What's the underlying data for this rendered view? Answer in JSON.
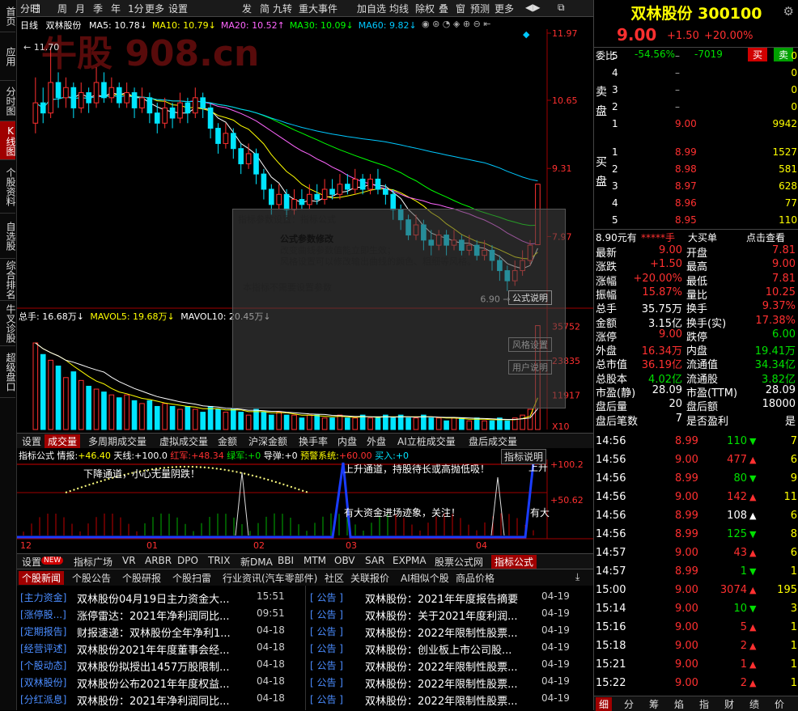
{
  "left_tabs": [
    "首页",
    "应用",
    "分时图",
    "K线图",
    "个股资料",
    "自选股",
    "综合排名",
    "牛叉诊股",
    "超级盘口"
  ],
  "toolbar": [
    "分时",
    "日",
    "周",
    "月",
    "季",
    "年",
    "1分",
    "更多",
    "设置",
    "发",
    "简",
    "九转",
    "重大事件",
    "加自选",
    "均线",
    "除权",
    "叠",
    "窗",
    "预测",
    "更多"
  ],
  "chart": {
    "period": "日线",
    "name": "双林股份",
    "ma": [
      {
        "label": "MA5:",
        "value": "10.78",
        "arrow": "↓",
        "color": "#ffffff"
      },
      {
        "label": "MA10:",
        "value": "10.79",
        "arrow": "↓",
        "color": "#ffff00"
      },
      {
        "label": "MA20:",
        "value": "10.52",
        "arrow": "↑",
        "color": "#ff66ff"
      },
      {
        "label": "MA30:",
        "value": "10.09",
        "arrow": "↓",
        "color": "#00ff00"
      },
      {
        "label": "MA60:",
        "value": "9.82",
        "arrow": "↓",
        "color": "#00c8ff"
      }
    ],
    "y_labels": [
      "11.97",
      "10.65",
      "9.31",
      "7.97"
    ],
    "high_label": "11.70",
    "low_label": "6.90",
    "watermark": "牛股 908.cn",
    "vol_legend": {
      "total": "总手: 16.68万↓",
      "mavol5": "MAVOL5: 19.68万↓",
      "mavol10": "MAVOL10: 20.45万↓"
    },
    "vol_y_labels": [
      "35752",
      "23835",
      "11917",
      "X10"
    ],
    "overlay": {
      "title": "指标参数设置：指标公式",
      "heading": "公式参数修改",
      "line1": "改变曲线参数值能立即生效；",
      "line2": "风格设置可以修改输出曲线的颜色、粗细等风格。",
      "note": "本指标不需要设置参数",
      "btn1": "公式说明",
      "btn2": "风格设置",
      "btn3": "用户说明"
    }
  },
  "chart_data": {
    "type": "candlestick",
    "candles": [
      {
        "o": 10.2,
        "c": 10.6,
        "h": 11.1,
        "l": 10.0
      },
      {
        "o": 10.6,
        "c": 10.4,
        "h": 10.9,
        "l": 10.2
      },
      {
        "o": 10.4,
        "c": 11.0,
        "h": 11.7,
        "l": 10.3
      },
      {
        "o": 11.0,
        "c": 10.7,
        "h": 11.2,
        "l": 10.5
      },
      {
        "o": 10.7,
        "c": 10.9,
        "h": 11.1,
        "l": 10.5
      },
      {
        "o": 10.9,
        "c": 10.5,
        "h": 11.0,
        "l": 10.3
      },
      {
        "o": 10.5,
        "c": 10.8,
        "h": 11.0,
        "l": 10.4
      },
      {
        "o": 10.8,
        "c": 10.6,
        "h": 10.9,
        "l": 10.4
      },
      {
        "o": 10.6,
        "c": 11.0,
        "h": 11.3,
        "l": 10.5
      },
      {
        "o": 11.0,
        "c": 10.7,
        "h": 11.2,
        "l": 10.6
      },
      {
        "o": 10.7,
        "c": 10.9,
        "h": 11.1,
        "l": 10.6
      },
      {
        "o": 10.9,
        "c": 10.6,
        "h": 11.0,
        "l": 10.5
      },
      {
        "o": 10.6,
        "c": 10.8,
        "h": 11.0,
        "l": 10.5
      },
      {
        "o": 10.8,
        "c": 10.5,
        "h": 10.9,
        "l": 10.3
      },
      {
        "o": 10.5,
        "c": 10.7,
        "h": 10.9,
        "l": 10.4
      },
      {
        "o": 10.7,
        "c": 10.4,
        "h": 10.8,
        "l": 10.2
      },
      {
        "o": 10.4,
        "c": 10.2,
        "h": 10.6,
        "l": 10.0
      },
      {
        "o": 10.2,
        "c": 10.5,
        "h": 10.7,
        "l": 10.1
      },
      {
        "o": 10.5,
        "c": 10.3,
        "h": 10.6,
        "l": 10.1
      },
      {
        "o": 10.3,
        "c": 10.6,
        "h": 10.8,
        "l": 10.2
      },
      {
        "o": 10.6,
        "c": 10.4,
        "h": 10.7,
        "l": 10.2
      },
      {
        "o": 10.4,
        "c": 10.7,
        "h": 10.9,
        "l": 10.3
      },
      {
        "o": 10.7,
        "c": 10.5,
        "h": 10.8,
        "l": 10.3
      },
      {
        "o": 10.5,
        "c": 10.1,
        "h": 10.6,
        "l": 9.9
      },
      {
        "o": 10.1,
        "c": 9.8,
        "h": 10.2,
        "l": 9.6
      },
      {
        "o": 9.8,
        "c": 10.0,
        "h": 10.2,
        "l": 9.7
      },
      {
        "o": 10.0,
        "c": 9.7,
        "h": 10.1,
        "l": 9.5
      },
      {
        "o": 9.7,
        "c": 9.4,
        "h": 9.8,
        "l": 9.2
      },
      {
        "o": 9.4,
        "c": 9.6,
        "h": 9.8,
        "l": 9.3
      },
      {
        "o": 9.6,
        "c": 9.2,
        "h": 9.7,
        "l": 9.0
      },
      {
        "o": 9.2,
        "c": 8.9,
        "h": 9.3,
        "l": 8.7
      },
      {
        "o": 8.9,
        "c": 8.6,
        "h": 9.0,
        "l": 8.4
      },
      {
        "o": 8.6,
        "c": 8.8,
        "h": 9.0,
        "l": 8.5
      },
      {
        "o": 8.8,
        "c": 8.5,
        "h": 8.9,
        "l": 8.3
      },
      {
        "o": 8.5,
        "c": 8.7,
        "h": 8.9,
        "l": 8.4
      },
      {
        "o": 8.7,
        "c": 8.6,
        "h": 8.9,
        "l": 8.5
      },
      {
        "o": 8.6,
        "c": 8.8,
        "h": 9.0,
        "l": 8.5
      },
      {
        "o": 8.8,
        "c": 8.7,
        "h": 9.0,
        "l": 8.6
      },
      {
        "o": 8.7,
        "c": 8.9,
        "h": 9.1,
        "l": 8.6
      },
      {
        "o": 8.9,
        "c": 8.8,
        "h": 9.1,
        "l": 8.7
      },
      {
        "o": 8.8,
        "c": 9.0,
        "h": 9.2,
        "l": 8.7
      },
      {
        "o": 9.0,
        "c": 8.9,
        "h": 9.2,
        "l": 8.8
      },
      {
        "o": 8.9,
        "c": 9.1,
        "h": 9.3,
        "l": 8.8
      },
      {
        "o": 9.1,
        "c": 8.9,
        "h": 9.2,
        "l": 8.8
      },
      {
        "o": 8.9,
        "c": 9.1,
        "h": 9.2,
        "l": 8.8
      },
      {
        "o": 9.1,
        "c": 8.9,
        "h": 9.3,
        "l": 8.8
      },
      {
        "o": 8.9,
        "c": 8.8,
        "h": 9.0,
        "l": 8.6
      },
      {
        "o": 8.8,
        "c": 8.5,
        "h": 8.9,
        "l": 8.3
      },
      {
        "o": 8.5,
        "c": 8.3,
        "h": 8.6,
        "l": 8.1
      },
      {
        "o": 8.3,
        "c": 8.0,
        "h": 8.4,
        "l": 7.9
      },
      {
        "o": 8.0,
        "c": 8.2,
        "h": 8.4,
        "l": 7.9
      },
      {
        "o": 8.2,
        "c": 7.9,
        "h": 8.3,
        "l": 7.7
      },
      {
        "o": 7.9,
        "c": 7.8,
        "h": 8.1,
        "l": 7.6
      },
      {
        "o": 7.8,
        "c": 8.0,
        "h": 8.1,
        "l": 7.7
      },
      {
        "o": 8.0,
        "c": 7.8,
        "h": 8.1,
        "l": 7.6
      },
      {
        "o": 7.8,
        "c": 7.9,
        "h": 8.1,
        "l": 7.7
      },
      {
        "o": 7.9,
        "c": 7.7,
        "h": 8.0,
        "l": 7.6
      },
      {
        "o": 7.7,
        "c": 7.8,
        "h": 8.0,
        "l": 7.6
      },
      {
        "o": 7.8,
        "c": 7.6,
        "h": 7.9,
        "l": 7.5
      },
      {
        "o": 7.6,
        "c": 7.7,
        "h": 7.9,
        "l": 7.5
      },
      {
        "o": 7.7,
        "c": 7.5,
        "h": 7.8,
        "l": 7.3
      },
      {
        "o": 7.5,
        "c": 7.3,
        "h": 7.6,
        "l": 7.1
      },
      {
        "o": 7.3,
        "c": 7.1,
        "h": 7.4,
        "l": 6.9
      },
      {
        "o": 7.1,
        "c": 7.3,
        "h": 7.5,
        "l": 7.0
      },
      {
        "o": 7.3,
        "c": 7.5,
        "h": 7.7,
        "l": 7.2
      },
      {
        "o": 7.5,
        "c": 7.8,
        "h": 7.9,
        "l": 7.4
      },
      {
        "o": 7.81,
        "c": 9.0,
        "h": 9.0,
        "l": 7.81
      }
    ],
    "volume": [
      30,
      26,
      24,
      22,
      18,
      20,
      17,
      15,
      14,
      13,
      12,
      11,
      12,
      10,
      9,
      10,
      8,
      9,
      8,
      7,
      8,
      7,
      6,
      8,
      7,
      6,
      7,
      6,
      5,
      7,
      6,
      5,
      6,
      5,
      5,
      4,
      5,
      5,
      4,
      4,
      5,
      4,
      4,
      5,
      4,
      4,
      5,
      4,
      5,
      4,
      4,
      5,
      4,
      4,
      3,
      4,
      4,
      3,
      4,
      3,
      3,
      4,
      3,
      4,
      5,
      7,
      36
    ]
  },
  "tabs1": [
    "设置",
    "成交量",
    "多周期成交量",
    "虚拟成交量",
    "金额",
    "沪深金额",
    "换手率",
    "内盘",
    "外盘",
    "AI立桩成交量",
    "盘后成交量"
  ],
  "tabs1_selected": 1,
  "indicator": {
    "title": "指标公式 情报:",
    "v1": "+46.40",
    "l2": "天线:",
    "v2": "+100.0",
    "l3": "红军:",
    "v3": "+48.34",
    "l4": "绿军:",
    "v4": "+0",
    "l5": "导弹:",
    "v5": "+0",
    "l6": "预警系统:",
    "v6": "+60.00",
    "l7": "买入:",
    "v7": "+0",
    "explain": "指标说明",
    "y1": "+100.2",
    "y2": "+50.62",
    "t1": "下降通道，小心无量阴跌！",
    "t2": "上升通道，持股待长或高抛低吸！",
    "t3": "上升",
    "t4": "有大资金进场迹象，关注！",
    "t5": "有大",
    "months": [
      "12",
      "01",
      "02",
      "03",
      "04"
    ]
  },
  "tabs2": [
    "设置",
    "NEW",
    "指标广场",
    "VR",
    "ARBR",
    "DPO",
    "TRIX",
    "新DMA",
    "BBI",
    "MTM",
    "OBV",
    "SAR",
    "EXPMA",
    "股票公式网",
    "指标公式"
  ],
  "news_tabs": [
    "个股新闻",
    "个股公告",
    "个股研报",
    "个股扫雷",
    "行业资讯(汽车零部件)",
    "社区",
    "关联报价",
    "AI相似个股",
    "商品价格"
  ],
  "news_left": [
    {
      "tag": "[主力资金]",
      "title": "双林股份04月19日主力资金大...",
      "time": "15:51"
    },
    {
      "tag": "[涨停股...]",
      "title": "涨停雷达：2021年净利润同比...",
      "time": "09:51"
    },
    {
      "tag": "[定期报告]",
      "title": "财报速递：双林股份全年净利1...",
      "time": "04-18"
    },
    {
      "tag": "[经营评述]",
      "title": "双林股份2021年年度董事会经...",
      "time": "04-18"
    },
    {
      "tag": "[个股动态]",
      "title": "双林股份拟授出1457万股限制...",
      "time": "04-18"
    },
    {
      "tag": "[双林股份]",
      "title": "双林股份公布2021年年度权益...",
      "time": "04-18"
    },
    {
      "tag": "[分红派息]",
      "title": "双林股份：2021年净利润同比...",
      "time": "04-18"
    }
  ],
  "news_right": [
    {
      "tag": "[  公告  ]",
      "title": "双林股份：2021年年度报告摘要",
      "time": "04-19"
    },
    {
      "tag": "[  公告  ]",
      "title": "双林股份：关于2021年度利润...",
      "time": "04-19"
    },
    {
      "tag": "[  公告  ]",
      "title": "双林股份：2022年限制性股票...",
      "time": "04-19"
    },
    {
      "tag": "[  公告  ]",
      "title": "双林股份：创业板上市公司股...",
      "time": "04-19"
    },
    {
      "tag": "[  公告  ]",
      "title": "双林股份：2022年限制性股票...",
      "time": "04-19"
    },
    {
      "tag": "[  公告  ]",
      "title": "双林股份：2022年限制性股票...",
      "time": "04-19"
    },
    {
      "tag": "[  公告  ]",
      "title": "双林股份：2022年限制性股票...",
      "time": "04-19"
    }
  ],
  "quote": {
    "name": "双林股份 300100",
    "price": "9.00",
    "change": "+1.50",
    "pct": "+20.00%",
    "weibi_label": "委比",
    "weibi": "-54.56%",
    "weicha": "-7019",
    "buy_btn": "买",
    "sell_btn": "卖",
    "sell_side": "卖盘",
    "buy_side": "买盘",
    "asks": [
      {
        "lvl": "5",
        "price": "–",
        "vol": "0"
      },
      {
        "lvl": "4",
        "price": "–",
        "vol": "0"
      },
      {
        "lvl": "3",
        "price": "–",
        "vol": "0"
      },
      {
        "lvl": "2",
        "price": "–",
        "vol": "0"
      },
      {
        "lvl": "1",
        "price": "9.00",
        "vol": "9942"
      }
    ],
    "bids": [
      {
        "lvl": "1",
        "price": "8.99",
        "vol": "1527"
      },
      {
        "lvl": "2",
        "price": "8.98",
        "vol": "581"
      },
      {
        "lvl": "3",
        "price": "8.97",
        "vol": "628"
      },
      {
        "lvl": "4",
        "price": "8.96",
        "vol": "77"
      },
      {
        "lvl": "5",
        "price": "8.95",
        "vol": "110"
      }
    ],
    "big_order": {
      "a": "8.90元有",
      "b": "*****手",
      "c": "大买单",
      "d": "点击查看"
    },
    "stats": [
      [
        "最新",
        "9.00",
        "开盘",
        "7.81"
      ],
      [
        "涨跌",
        "+1.50",
        "最高",
        "9.00"
      ],
      [
        "涨幅",
        "+20.00%",
        "最低",
        "7.81"
      ],
      [
        "振幅",
        "15.87%",
        "量比",
        "10.25"
      ],
      [
        "总手",
        "35.75万",
        "换手",
        "9.37%"
      ],
      [
        "金额",
        "3.15亿",
        "换手(实)",
        "17.38%"
      ],
      [
        "涨停",
        "9.00",
        "跌停",
        "6.00"
      ],
      [
        "外盘",
        "16.34万",
        "内盘",
        "19.41万"
      ],
      [
        "总市值",
        "36.19亿",
        "流通值",
        "34.34亿"
      ],
      [
        "总股本",
        "4.02亿",
        "流通股",
        "3.82亿"
      ],
      [
        "市盈(静)",
        "28.09",
        "市盈(TTM)",
        "28.09"
      ],
      [
        "盘后量",
        "20",
        "盘后额",
        "18000"
      ],
      [
        "盘后笔数",
        "7",
        "是否盈利",
        "是"
      ]
    ],
    "ticks": [
      {
        "t": "14:56",
        "p": "8.99",
        "v": "110",
        "d": "down",
        "n": "7"
      },
      {
        "t": "14:56",
        "p": "9.00",
        "v": "477",
        "d": "up",
        "n": "6"
      },
      {
        "t": "14:56",
        "p": "8.99",
        "v": "80",
        "d": "down",
        "n": "9"
      },
      {
        "t": "14:56",
        "p": "9.00",
        "v": "142",
        "d": "up",
        "n": "11"
      },
      {
        "t": "14:56",
        "p": "8.99",
        "v": "108",
        "d": "neutral",
        "n": "6"
      },
      {
        "t": "14:56",
        "p": "8.99",
        "v": "125",
        "d": "down",
        "n": "8"
      },
      {
        "t": "14:57",
        "p": "9.00",
        "v": "43",
        "d": "up",
        "n": "6"
      },
      {
        "t": "14:57",
        "p": "8.99",
        "v": "1",
        "d": "down",
        "n": "1"
      },
      {
        "t": "15:00",
        "p": "9.00",
        "v": "3074",
        "d": "up",
        "n": "195"
      },
      {
        "t": "15:14",
        "p": "9.00",
        "v": "10",
        "d": "down",
        "n": "3"
      },
      {
        "t": "15:16",
        "p": "9.00",
        "v": "5",
        "d": "up",
        "n": "1"
      },
      {
        "t": "15:18",
        "p": "9.00",
        "v": "2",
        "d": "up",
        "n": "1"
      },
      {
        "t": "15:21",
        "p": "9.00",
        "v": "1",
        "d": "up",
        "n": "1"
      },
      {
        "t": "15:22",
        "p": "9.00",
        "v": "2",
        "d": "up",
        "n": "1"
      }
    ],
    "bottom_tabs": [
      "细",
      "分",
      "筹",
      "焰",
      "指",
      "财",
      "绩",
      "价"
    ]
  }
}
